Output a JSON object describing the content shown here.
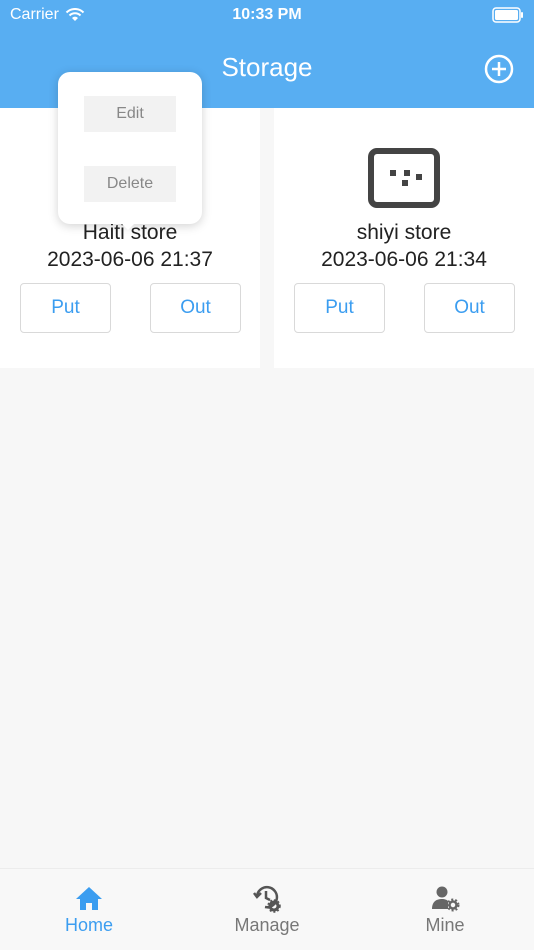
{
  "status_bar": {
    "carrier": "Carrier",
    "time": "10:33 PM"
  },
  "header": {
    "title": "Storage",
    "add_icon": "plus-circle-icon"
  },
  "stores": [
    {
      "name": "Haiti  store",
      "date": "2023-06-06 21:37",
      "put_label": "Put",
      "out_label": "Out"
    },
    {
      "name": "shiyi store",
      "date": "2023-06-06 21:34",
      "put_label": "Put",
      "out_label": "Out"
    }
  ],
  "popup_menu": {
    "edit_label": "Edit",
    "delete_label": "Delete"
  },
  "tabbar": {
    "items": [
      {
        "label": "Home",
        "icon": "home-icon",
        "active": true
      },
      {
        "label": "Manage",
        "icon": "history-gear-icon",
        "active": false
      },
      {
        "label": "Mine",
        "icon": "user-gear-icon",
        "active": false
      }
    ]
  },
  "colors": {
    "header_bg": "#58aef2",
    "accent": "#3b9df0",
    "background": "#f7f7f7"
  }
}
